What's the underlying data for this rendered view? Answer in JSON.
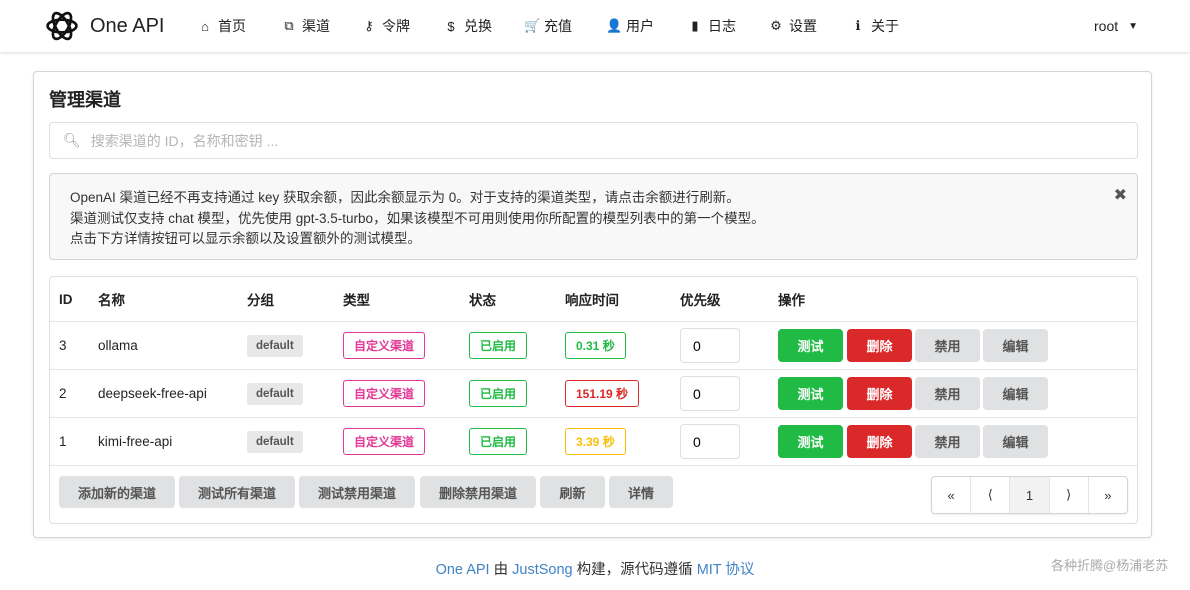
{
  "nav": {
    "brand": "One API",
    "items": [
      {
        "icon": "home-icon",
        "glyph": "⌂",
        "label": "首页"
      },
      {
        "icon": "sitemap-icon",
        "glyph": "⧉",
        "label": "渠道"
      },
      {
        "icon": "key-icon",
        "glyph": "⚷",
        "label": "令牌"
      },
      {
        "icon": "dollar-icon",
        "glyph": "$",
        "label": "兑换"
      },
      {
        "icon": "cart-icon",
        "glyph": "🛒",
        "label": "充值"
      },
      {
        "icon": "user-icon",
        "glyph": "👤",
        "label": "用户"
      },
      {
        "icon": "book-icon",
        "glyph": "▮",
        "label": "日志"
      },
      {
        "icon": "gear-icon",
        "glyph": "⚙",
        "label": "设置"
      },
      {
        "icon": "info-icon",
        "glyph": "ℹ",
        "label": "关于"
      }
    ],
    "user": "root"
  },
  "page": {
    "title": "管理渠道",
    "search_placeholder": "搜索渠道的 ID，名称和密钥 ...",
    "message": [
      "OpenAI 渠道已经不再支持通过 key 获取余额，因此余额显示为 0。对于支持的渠道类型，请点击余额进行刷新。",
      "渠道测试仅支持 chat 模型，优先使用 gpt-3.5-turbo，如果该模型不可用则使用你所配置的模型列表中的第一个模型。",
      "点击下方详情按钮可以显示余额以及设置额外的测试模型。"
    ]
  },
  "table": {
    "headers": [
      "ID",
      "名称",
      "分组",
      "类型",
      "状态",
      "响应时间",
      "优先级",
      "操作"
    ],
    "rows": [
      {
        "id": "3",
        "name": "ollama",
        "group": "default",
        "type": "自定义渠道",
        "status": "已启用",
        "time": "0.31 秒",
        "time_level": "green",
        "priority": "0"
      },
      {
        "id": "2",
        "name": "deepseek-free-api",
        "group": "default",
        "type": "自定义渠道",
        "status": "已启用",
        "time": "151.19 秒",
        "time_level": "red",
        "priority": "0"
      },
      {
        "id": "1",
        "name": "kimi-free-api",
        "group": "default",
        "type": "自定义渠道",
        "status": "已启用",
        "time": "3.39 秒",
        "time_level": "yellow",
        "priority": "0"
      }
    ],
    "actions": {
      "test": "测试",
      "delete": "删除",
      "disable": "禁用",
      "edit": "编辑"
    }
  },
  "footer_buttons": [
    "添加新的渠道",
    "测试所有渠道",
    "测试禁用渠道",
    "删除禁用渠道",
    "刷新",
    "详情"
  ],
  "pager": [
    "«",
    "⟨",
    "1",
    "⟩",
    "»"
  ],
  "footer": {
    "p1": "One API",
    "p2": " 由 ",
    "p3": "JustSong",
    "p4": " 构建，源代码遵循 ",
    "p5": "MIT 协议"
  },
  "watermark": "各种折腾@杨浦老苏"
}
